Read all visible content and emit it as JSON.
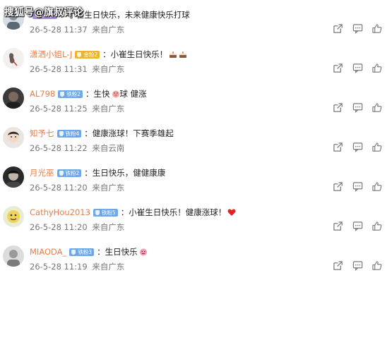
{
  "watermark": "搜狐号@旗叔评论",
  "comments": [
    {
      "user": "",
      "badge": "铁粉2",
      "badge_color": "purple",
      "text": "：小崔生日快乐，未来健康快乐打球",
      "emojis": [],
      "date": "26-5-28 11:37",
      "location": "来自广东"
    },
    {
      "user": "潇洒小姐L-J",
      "badge": "金粉2",
      "badge_color": "gold",
      "text": "：小崔生日快乐！",
      "emojis": [
        "cake-emoji",
        "cake-emoji"
      ],
      "date": "26-5-28 11:31",
      "location": "来自广东"
    },
    {
      "user": "AL798",
      "badge": "铁粉2",
      "badge_color": "blue",
      "text": "：生快",
      "emojis": [
        "pig-emoji"
      ],
      "text2": "球 健涨",
      "date": "26-5-28 11:25",
      "location": "来自广东"
    },
    {
      "user": "知予七",
      "badge": "铁粉4",
      "badge_color": "blue",
      "text": "：健康涨球！下赛季雄起",
      "emojis": [],
      "date": "26-5-28 11:22",
      "location": "来自云南"
    },
    {
      "user": "月光巫",
      "badge": "铁粉2",
      "badge_color": "blue",
      "text": "：生日快乐，健健康康",
      "emojis": [],
      "date": "26-5-28 11:20",
      "location": "来自广东"
    },
    {
      "user": "CathyHou2013",
      "badge": "铁粉5",
      "badge_color": "blue",
      "text": "：小崔生日快乐！健康涨球！",
      "emojis": [
        "heart-emoji"
      ],
      "date": "26-5-28 11:20",
      "location": "来自广东"
    },
    {
      "user": "MIAODA_",
      "badge": "铁粉3",
      "badge_color": "blue",
      "text": "：生日快乐",
      "emojis": [
        "face-emoji"
      ],
      "date": "26-5-28 11:19",
      "location": "来自广东"
    }
  ]
}
